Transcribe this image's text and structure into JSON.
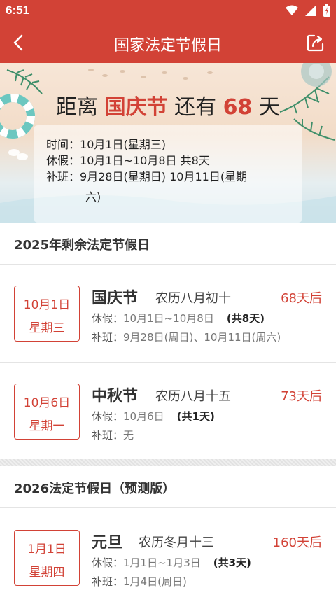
{
  "status_bar": {
    "time": "6:51"
  },
  "header": {
    "title": "国家法定节假日"
  },
  "hero": {
    "countdown_prefix": "距离",
    "holiday": "国庆节",
    "countdown_mid": "还有",
    "days": "68",
    "countdown_suffix": "天",
    "time_label": "时间：",
    "time_value": "10月1日(星期三)",
    "vacation_label": "休假：",
    "vacation_value": "10月1日~10月8日  共8天",
    "makeup_label": "补班：",
    "makeup_value": "9月28日(星期日)  10月11日(星期",
    "makeup_overflow": "六)"
  },
  "sections": [
    {
      "title": "2025年剩余法定节假日"
    },
    {
      "title": "2026法定节假日（预测版）"
    }
  ],
  "holidays": [
    {
      "date": "10月1日",
      "weekday": "星期三",
      "name": "国庆节",
      "lunar": "农历八月初十",
      "days_after": "68天后",
      "vacation_label": "休假：",
      "vacation": "10月1日~10月8日",
      "total": "(共8天)",
      "makeup_label": "补班：",
      "makeup": "9月28日(周日)、10月11日(周六)"
    },
    {
      "date": "10月6日",
      "weekday": "星期一",
      "name": "中秋节",
      "lunar": "农历八月十五",
      "days_after": "73天后",
      "vacation_label": "休假：",
      "vacation": "10月6日",
      "total": "(共1天)",
      "makeup_label": "补班：",
      "makeup": "无"
    },
    {
      "date": "1月1日",
      "weekday": "星期四",
      "name": "元旦",
      "lunar": "农历冬月十三",
      "days_after": "160天后",
      "vacation_label": "休假：",
      "vacation": "1月1日~1月3日",
      "total": "(共3天)",
      "makeup_label": "补班：",
      "makeup": "1月4日(周日)"
    }
  ],
  "icons": {
    "back": "back-arrow-icon",
    "share": "share-icon",
    "wifi": "wifi-icon",
    "signal": "signal-icon",
    "battery": "battery-icon"
  },
  "colors": {
    "primary": "#d24236",
    "accent_text": "#d24236"
  }
}
